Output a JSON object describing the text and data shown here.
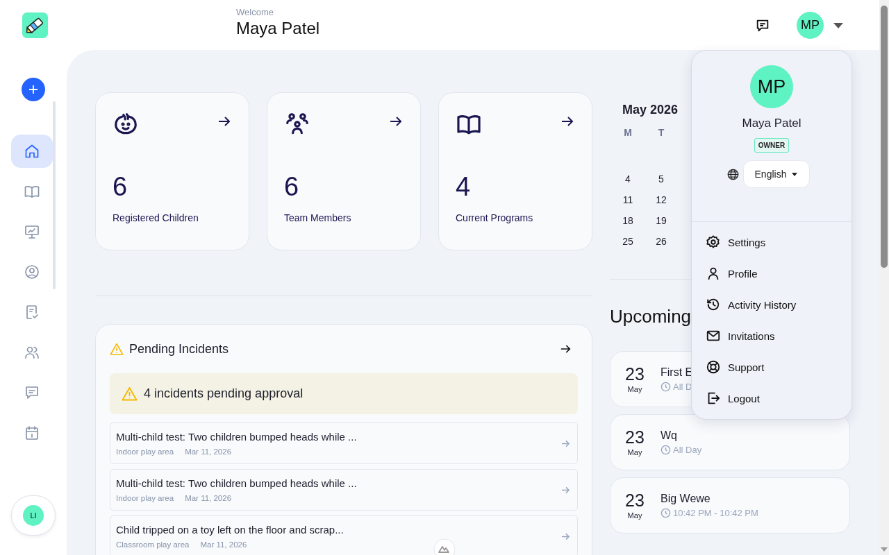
{
  "header": {
    "greeting": "Welcome",
    "user_name": "Maya Patel",
    "avatar_initials": "MP"
  },
  "sidebar": {
    "items": [
      {
        "selected": true
      },
      {
        "selected": false
      },
      {
        "selected": false
      },
      {
        "selected": false
      },
      {
        "selected": false
      },
      {
        "selected": false
      },
      {
        "selected": false
      },
      {
        "selected": false
      }
    ],
    "user_initials": "LI"
  },
  "stats": [
    {
      "value": "6",
      "label": "Registered Children"
    },
    {
      "value": "6",
      "label": "Team Members"
    },
    {
      "value": "4",
      "label": "Current Programs"
    }
  ],
  "incidents": {
    "title": "Pending Incidents",
    "alert": "4 incidents pending approval",
    "items": [
      {
        "title": "Multi-child test: Two children bumped heads while ...",
        "location": "Indoor play area",
        "date": "Mar 11, 2026"
      },
      {
        "title": "Multi-child test: Two children bumped heads while ...",
        "location": "Indoor play area",
        "date": "Mar 11, 2026"
      },
      {
        "title": "Child tripped on a toy left on the floor and scrap...",
        "location": "Classroom play area",
        "date": "Mar 11, 2026"
      }
    ]
  },
  "calendar": {
    "title": "May 2026",
    "weekdays": [
      "M",
      "T"
    ],
    "weeks": [
      [
        "4",
        "5"
      ],
      [
        "11",
        "12"
      ],
      [
        "18",
        "19"
      ],
      [
        "25",
        "26"
      ]
    ]
  },
  "upcoming": {
    "title": "Upcoming",
    "events": [
      {
        "day": "23",
        "month": "May",
        "title": "First E",
        "time": "All D"
      },
      {
        "day": "23",
        "month": "May",
        "title": "Wq",
        "time": "All Day"
      },
      {
        "day": "23",
        "month": "May",
        "title": "Big Wewe",
        "time": "10:42 PM - 10:42 PM"
      }
    ]
  },
  "user_menu": {
    "initials": "MP",
    "name": "Maya Patel",
    "role": "OWNER",
    "language": "English",
    "items": [
      "Settings",
      "Profile",
      "Activity History",
      "Invitations",
      "Support",
      "Logout"
    ]
  }
}
